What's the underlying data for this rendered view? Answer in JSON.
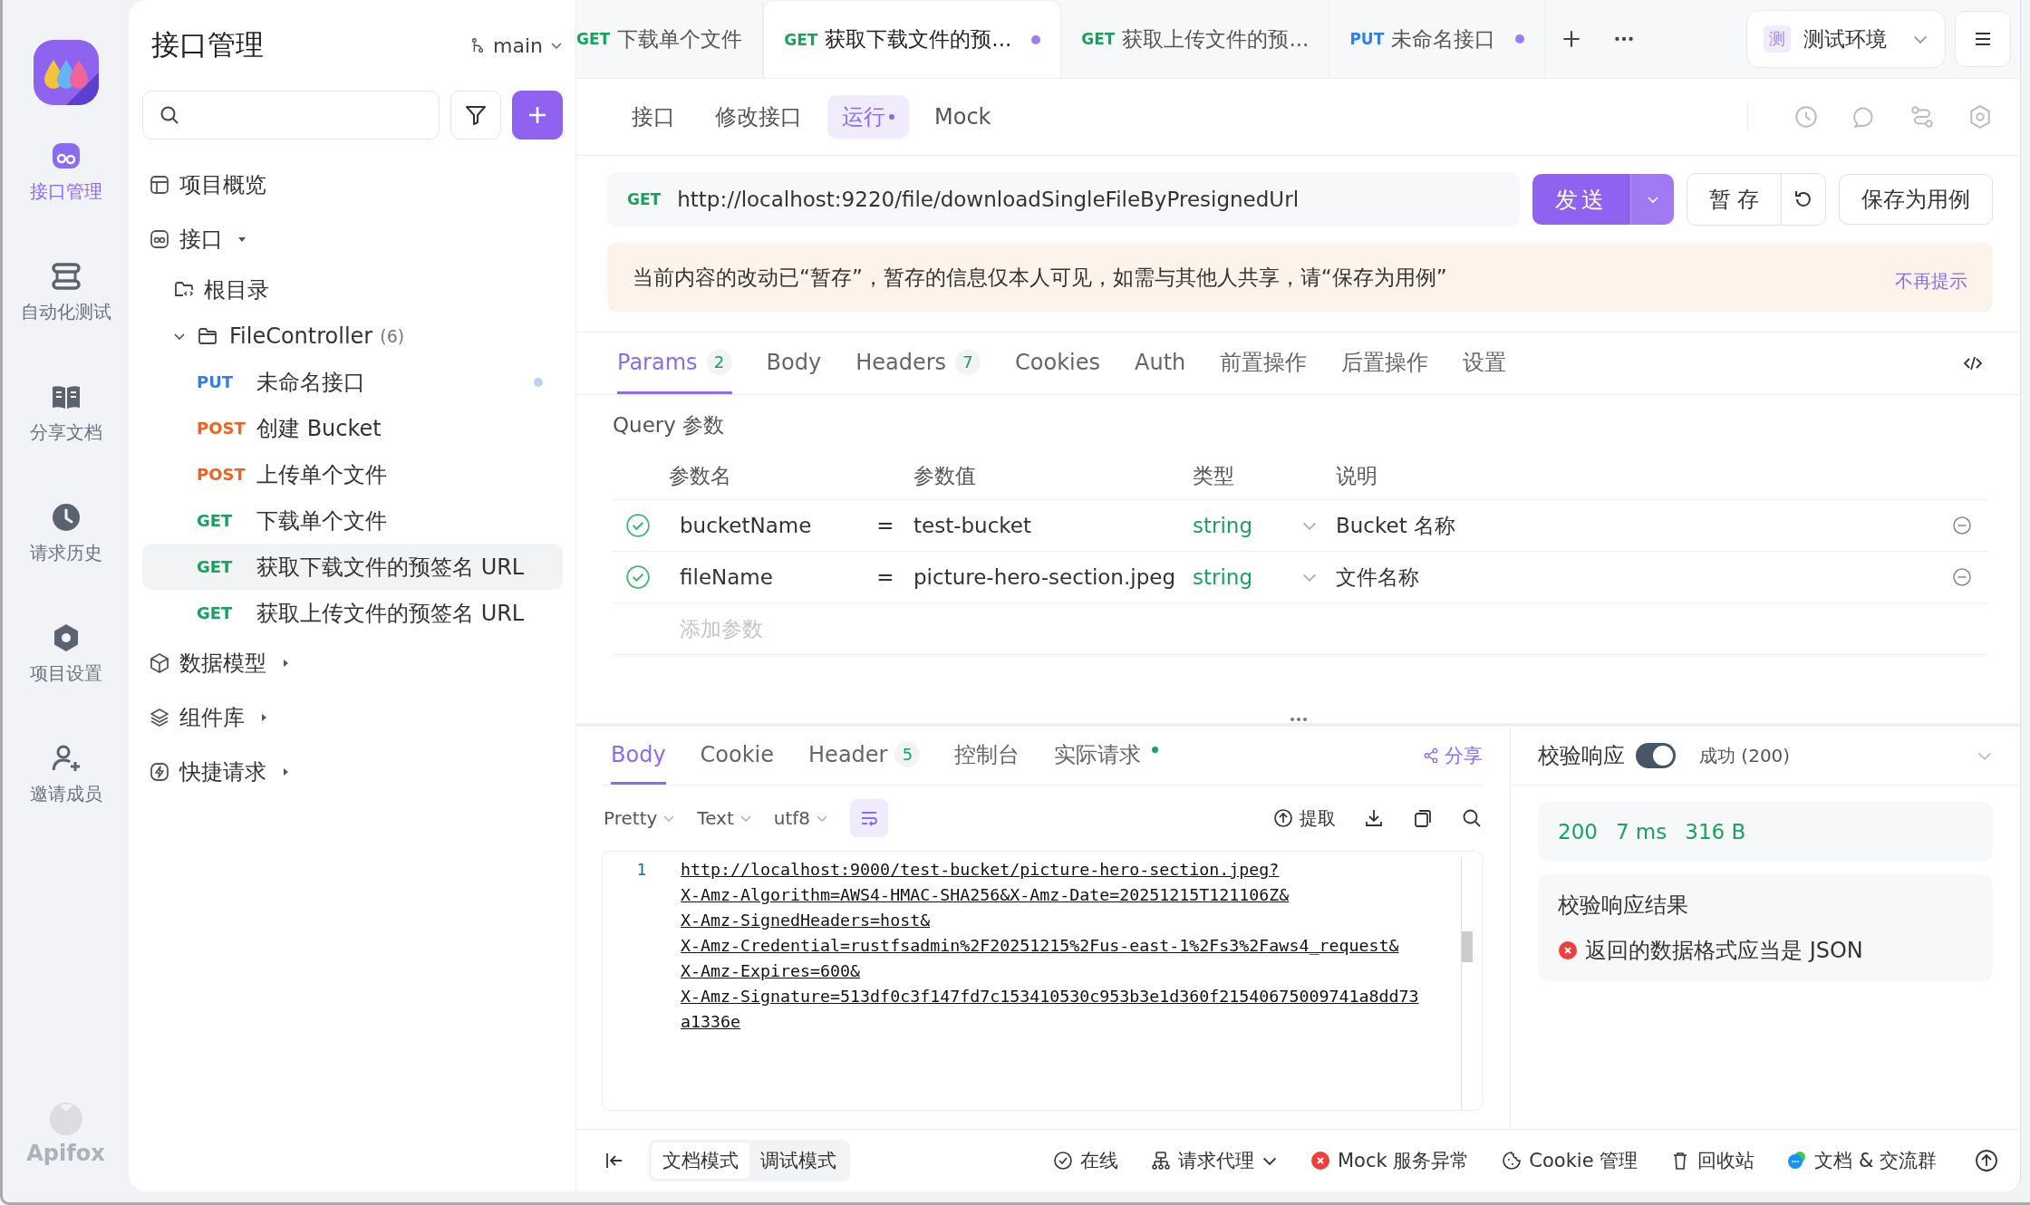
{
  "rail": {
    "brand": "Apifox",
    "items": [
      {
        "kind": "api",
        "label": "接口管理",
        "selected": true
      },
      {
        "kind": "auto",
        "label": "自动化测试",
        "selected": false
      },
      {
        "kind": "docs",
        "label": "分享文档",
        "selected": false
      },
      {
        "kind": "history",
        "label": "请求历史",
        "selected": false
      },
      {
        "kind": "settings",
        "label": "项目设置",
        "selected": false
      },
      {
        "kind": "invite",
        "label": "邀请成员",
        "selected": false
      }
    ]
  },
  "sidebar": {
    "title": "接口管理",
    "branch": "main",
    "tree": [
      {
        "kind": "overview",
        "label": "项目概览"
      },
      {
        "kind": "api",
        "label": "接口",
        "expanded": true,
        "children": [
          {
            "kind": "root",
            "label": "根目录"
          },
          {
            "kind": "folder",
            "label": "FileController",
            "count": "(6)",
            "expanded": true,
            "children": [
              {
                "kind": "endpoint",
                "method": "PUT",
                "color": "#2f80ed",
                "label": "未命名接口",
                "selected": false,
                "unsaved": true
              },
              {
                "kind": "endpoint",
                "method": "POST",
                "color": "#f2611d",
                "label": "创建 Bucket",
                "selected": false,
                "unsaved": false
              },
              {
                "kind": "endpoint",
                "method": "POST",
                "color": "#f2611d",
                "label": "上传单个文件",
                "selected": false,
                "unsaved": false
              },
              {
                "kind": "endpoint",
                "method": "GET",
                "color": "#17a35d",
                "label": "下载单个文件",
                "selected": false,
                "unsaved": false
              },
              {
                "kind": "endpoint",
                "method": "GET",
                "color": "#17a35d",
                "label": "获取下载文件的预签名 URL",
                "selected": true,
                "unsaved": false
              },
              {
                "kind": "endpoint",
                "method": "GET",
                "color": "#17a35d",
                "label": "获取上传文件的预签名 URL",
                "selected": false,
                "unsaved": false
              }
            ]
          }
        ]
      },
      {
        "kind": "models",
        "label": "数据模型",
        "expanded": false
      },
      {
        "kind": "components",
        "label": "组件库",
        "expanded": false
      },
      {
        "kind": "quick",
        "label": "快捷请求",
        "expanded": false
      }
    ]
  },
  "tabs": [
    {
      "method": "GET",
      "color": "#17a35d",
      "title": "下载单个文件",
      "selected": false,
      "unsaved": false
    },
    {
      "method": "GET",
      "color": "#17a35d",
      "title": "获取下载文件的预...",
      "selected": true,
      "unsaved": true
    },
    {
      "method": "GET",
      "color": "#17a35d",
      "title": "获取上传文件的预...",
      "selected": false,
      "unsaved": false
    },
    {
      "method": "PUT",
      "color": "#2f80ed",
      "title": "未命名接口",
      "selected": false,
      "unsaved": true
    }
  ],
  "environment": {
    "badge": "测",
    "name": "测试环境"
  },
  "subtabs": [
    {
      "label": "接口",
      "selected": false,
      "dot": false
    },
    {
      "label": "修改接口",
      "selected": false,
      "dot": false
    },
    {
      "label": "运行",
      "selected": true,
      "dot": true
    },
    {
      "label": "Mock",
      "selected": false,
      "dot": false
    }
  ],
  "request": {
    "method": "GET",
    "url": "http://localhost:9220/file/downloadSingleFileByPresignedUrl",
    "send": "发送",
    "stash": "暂 存",
    "save_case": "保存为用例"
  },
  "notice": {
    "text": "当前内容的改动已“暂存”，暂存的信息仅本人可见，如需与其他人共享，请“保存为用例”",
    "dismiss": "不再提示"
  },
  "param_tabs": [
    {
      "label": "Params",
      "count": "2",
      "selected": true
    },
    {
      "label": "Body",
      "selected": false
    },
    {
      "label": "Headers",
      "count": "7",
      "selected": false
    },
    {
      "label": "Cookies",
      "selected": false
    },
    {
      "label": "Auth",
      "selected": false
    },
    {
      "label": "前置操作",
      "selected": false
    },
    {
      "label": "后置操作",
      "selected": false
    },
    {
      "label": "设置",
      "selected": false
    }
  ],
  "query": {
    "title": "Query 参数",
    "columns": [
      "参数名",
      "参数值",
      "类型",
      "说明"
    ],
    "rows": [
      {
        "enabled": true,
        "name": "bucketName",
        "eq": "=",
        "value": "test-bucket",
        "type": "string",
        "desc": "Bucket 名称"
      },
      {
        "enabled": true,
        "name": "fileName",
        "eq": "=",
        "value": "picture-hero-section.jpeg",
        "type": "string",
        "desc": "文件名称"
      }
    ],
    "add_placeholder": "添加参数"
  },
  "response": {
    "tabs": [
      {
        "label": "Body",
        "selected": true,
        "dot": false
      },
      {
        "label": "Cookie",
        "selected": false,
        "dot": false
      },
      {
        "label": "Header",
        "count": "5",
        "selected": false,
        "dot": false
      },
      {
        "label": "控制台",
        "selected": false,
        "dot": false
      },
      {
        "label": "实际请求",
        "selected": false,
        "dot": true
      }
    ],
    "share": "分享",
    "formats": [
      "Pretty",
      "Text",
      "utf8"
    ],
    "wrap": true,
    "extract": "提取",
    "code": {
      "line_number": "1",
      "lines": [
        "http://localhost:9000/test-bucket/picture-hero-section.jpeg?",
        "X-Amz-Algorithm=AWS4-HMAC-SHA256&X-Amz-Date=20251215T121106Z&",
        "X-Amz-SignedHeaders=host&",
        "X-Amz-Credential=rustfsadmin%2F20251215%2Fus-east-1%2Fs3%2Faws4_request&",
        "X-Amz-Expires=600&",
        "X-Amz-Signature=513df0c3f147fd7c153410530c953b3e1d360f21540675009741a8dd73",
        "a1336e"
      ]
    }
  },
  "validation": {
    "label": "校验响应",
    "on": true,
    "status": "成功 (200)",
    "stats": [
      "200",
      "7 ms",
      "316 B"
    ],
    "result_title": "校验响应结果",
    "errors": [
      "返回的数据格式应当是 JSON"
    ]
  },
  "footer": {
    "modes": [
      {
        "label": "文档模式",
        "selected": true
      },
      {
        "label": "调试模式",
        "selected": false
      }
    ],
    "items": [
      {
        "kind": "online",
        "label": "在线"
      },
      {
        "kind": "proxy",
        "label": "请求代理"
      },
      {
        "kind": "mock",
        "label": "Mock 服务异常"
      },
      {
        "kind": "cookie",
        "label": "Cookie 管理"
      },
      {
        "kind": "trash",
        "label": "回收站"
      },
      {
        "kind": "chat",
        "label": "文档 & 交流群"
      }
    ]
  }
}
